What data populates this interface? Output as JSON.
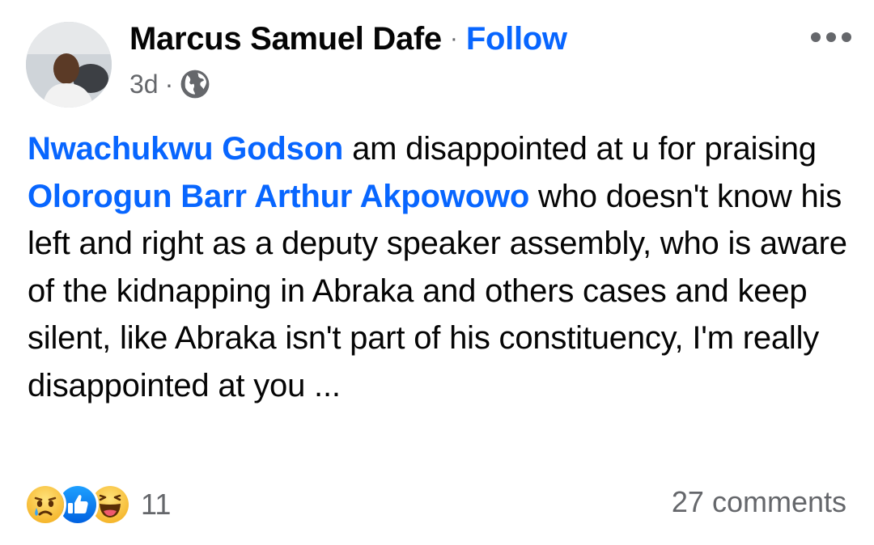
{
  "post": {
    "author": "Marcus Samuel Dafe",
    "separator": "·",
    "follow_label": "Follow",
    "time": "3d",
    "meta_separator": "·",
    "audience_icon": "globe-icon",
    "more_icon": "more-options-icon",
    "body": [
      {
        "type": "mention",
        "text": "Nwachukwu Godson"
      },
      {
        "type": "text",
        "text": " am disappointed at u for praising "
      },
      {
        "type": "mention",
        "text": "Olorogun Barr Arthur Akpowowo"
      },
      {
        "type": "text",
        "text": " who doesn't know his left and right as a deputy speaker assembly, who is aware of the kidnapping in Abraka and others cases and keep silent, like Abraka isn't part of his constituency, I'm really disappointed at you ..."
      }
    ]
  },
  "footer": {
    "reaction_icons": [
      "sad-reaction-icon",
      "like-reaction-icon",
      "haha-reaction-icon"
    ],
    "reaction_count": "11",
    "comments_label": "27 comments"
  },
  "colors": {
    "link": "#0866ff",
    "secondary_text": "#65676b",
    "primary_text": "#050505"
  }
}
